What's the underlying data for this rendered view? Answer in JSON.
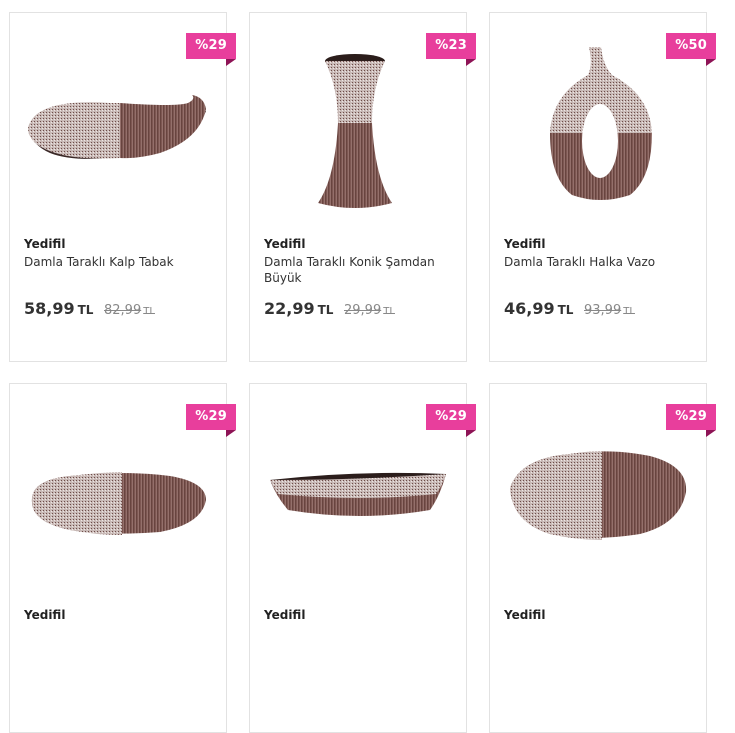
{
  "products": [
    {
      "badge": "%29",
      "brand": "Yedifil",
      "name": "Damla Taraklı Kalp Tabak",
      "price": "58,99",
      "price_currency": "TL",
      "old_price": "82,99",
      "old_currency": "TL"
    },
    {
      "badge": "%23",
      "brand": "Yedifil",
      "name": "Damla Taraklı Konik Şamdan Büyük",
      "price": "22,99",
      "price_currency": "TL",
      "old_price": "29,99",
      "old_currency": "TL"
    },
    {
      "badge": "%50",
      "brand": "Yedifil",
      "name": "Damla Taraklı Halka Vazo",
      "price": "46,99",
      "price_currency": "TL",
      "old_price": "93,99",
      "old_currency": "TL"
    },
    {
      "badge": "%29",
      "brand": "Yedifil"
    },
    {
      "badge": "%29",
      "brand": "Yedifil"
    },
    {
      "badge": "%29",
      "brand": "Yedifil"
    }
  ],
  "colors": {
    "badge": "#e83e9c",
    "badge_fold": "#8e1456",
    "ceramic_light": "#d9ccc9",
    "ceramic_dark": "#7a5550"
  }
}
